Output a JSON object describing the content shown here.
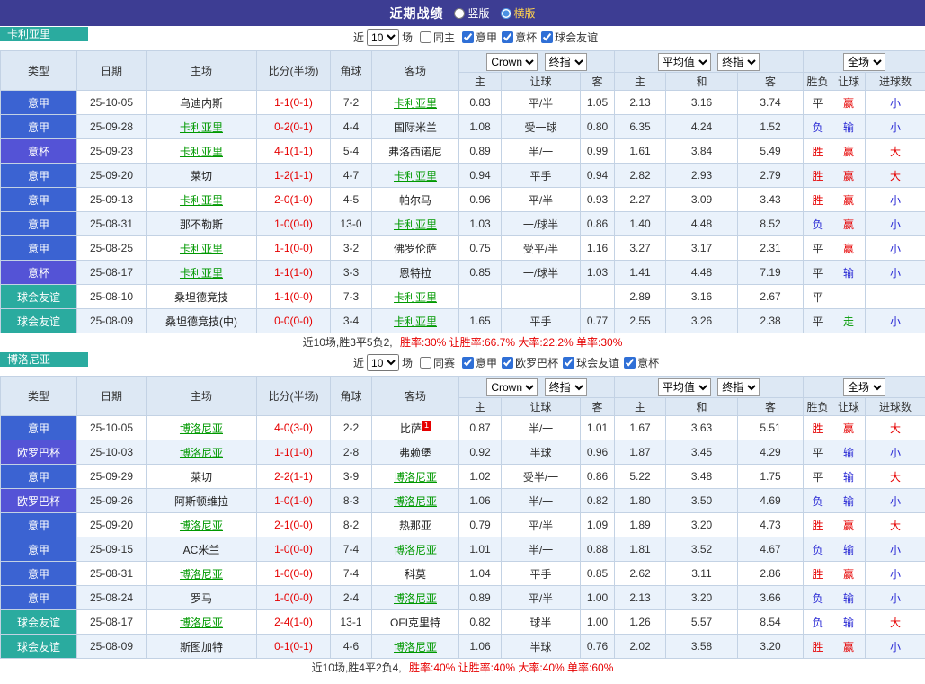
{
  "header": {
    "title": "近期战绩",
    "vertical_label": "竖版",
    "horizontal_label": "横版"
  },
  "labels": {
    "near": "近",
    "matches": "场"
  },
  "columns": {
    "type": "类型",
    "date": "日期",
    "home": "主场",
    "score": "比分(半场)",
    "corners": "角球",
    "away": "客场",
    "ah_home": "主",
    "ah_line": "让球",
    "ah_away": "客",
    "eu_home": "主",
    "eu_draw": "和",
    "eu_away": "客",
    "result": "胜负",
    "handicap": "让球",
    "goals": "进球数"
  },
  "selects": {
    "bookmaker": "Crown",
    "time": "终指",
    "euro_source": "平均值",
    "scope": "全场"
  },
  "league_colors": {
    "意甲": "#3b63d2",
    "意杯": "#5453d6",
    "欧罗巴杯": "#5453d6",
    "球会友谊": "#2aab9f"
  },
  "result_colors": {
    "胜": "#e60000",
    "平": "#333333",
    "负": "#2b2bd5",
    "赢": "#e60000",
    "输": "#2b2bd5",
    "走": "#009900",
    "大": "#e60000",
    "小": "#2b2bd5"
  },
  "sections": [
    {
      "team": "卡利亚里",
      "filters": {
        "count": "10",
        "same_label": "同主",
        "leagues": [
          "意甲",
          "意杯",
          "球会友谊"
        ]
      },
      "rows": [
        {
          "league": "意甲",
          "date": "25-10-05",
          "home": "乌迪内斯",
          "score": "1-1(0-1)",
          "corners": "7-2",
          "away": "卡利亚里",
          "ah_home": "0.83",
          "ah_line": "平/半",
          "ah_away": "1.05",
          "eu_home": "2.13",
          "eu_draw": "3.16",
          "eu_away": "3.74",
          "result": "平",
          "handicap_result": "赢",
          "goals": "小"
        },
        {
          "league": "意甲",
          "date": "25-09-28",
          "home": "卡利亚里",
          "score": "0-2(0-1)",
          "corners": "4-4",
          "away": "国际米兰",
          "ah_home": "1.08",
          "ah_line": "受一球",
          "ah_away": "0.80",
          "eu_home": "6.35",
          "eu_draw": "4.24",
          "eu_away": "1.52",
          "result": "负",
          "handicap_result": "输",
          "goals": "小"
        },
        {
          "league": "意杯",
          "date": "25-09-23",
          "home": "卡利亚里",
          "score": "4-1(1-1)",
          "corners": "5-4",
          "away": "弗洛西诺尼",
          "ah_home": "0.89",
          "ah_line": "半/一",
          "ah_away": "0.99",
          "eu_home": "1.61",
          "eu_draw": "3.84",
          "eu_away": "5.49",
          "result": "胜",
          "handicap_result": "赢",
          "goals": "大"
        },
        {
          "league": "意甲",
          "date": "25-09-20",
          "home": "莱切",
          "score": "1-2(1-1)",
          "corners": "4-7",
          "away": "卡利亚里",
          "ah_home": "0.94",
          "ah_line": "平手",
          "ah_away": "0.94",
          "eu_home": "2.82",
          "eu_draw": "2.93",
          "eu_away": "2.79",
          "result": "胜",
          "handicap_result": "赢",
          "goals": "大"
        },
        {
          "league": "意甲",
          "date": "25-09-13",
          "home": "卡利亚里",
          "score": "2-0(1-0)",
          "corners": "4-5",
          "away": "帕尔马",
          "ah_home": "0.96",
          "ah_line": "平/半",
          "ah_away": "0.93",
          "eu_home": "2.27",
          "eu_draw": "3.09",
          "eu_away": "3.43",
          "result": "胜",
          "handicap_result": "赢",
          "goals": "小"
        },
        {
          "league": "意甲",
          "date": "25-08-31",
          "home": "那不勒斯",
          "score": "1-0(0-0)",
          "corners": "13-0",
          "away": "卡利亚里",
          "ah_home": "1.03",
          "ah_line": "一/球半",
          "ah_away": "0.86",
          "eu_home": "1.40",
          "eu_draw": "4.48",
          "eu_away": "8.52",
          "result": "负",
          "handicap_result": "赢",
          "goals": "小"
        },
        {
          "league": "意甲",
          "date": "25-08-25",
          "home": "卡利亚里",
          "score": "1-1(0-0)",
          "corners": "3-2",
          "away": "佛罗伦萨",
          "ah_home": "0.75",
          "ah_line": "受平/半",
          "ah_away": "1.16",
          "eu_home": "3.27",
          "eu_draw": "3.17",
          "eu_away": "2.31",
          "result": "平",
          "handicap_result": "赢",
          "goals": "小"
        },
        {
          "league": "意杯",
          "date": "25-08-17",
          "home": "卡利亚里",
          "score": "1-1(1-0)",
          "corners": "3-3",
          "away": "恩特拉",
          "ah_home": "0.85",
          "ah_line": "一/球半",
          "ah_away": "1.03",
          "eu_home": "1.41",
          "eu_draw": "4.48",
          "eu_away": "7.19",
          "result": "平",
          "handicap_result": "输",
          "goals": "小"
        },
        {
          "league": "球会友谊",
          "date": "25-08-10",
          "home": "桑坦德竞技",
          "score": "1-1(0-0)",
          "corners": "7-3",
          "away": "卡利亚里",
          "ah_home": "",
          "ah_line": "",
          "ah_away": "",
          "eu_home": "2.89",
          "eu_draw": "3.16",
          "eu_away": "2.67",
          "result": "平",
          "handicap_result": "",
          "goals": ""
        },
        {
          "league": "球会友谊",
          "date": "25-08-09",
          "home": "桑坦德竞技(中)",
          "score": "0-0(0-0)",
          "corners": "3-4",
          "away": "卡利亚里",
          "ah_home": "1.65",
          "ah_line": "平手",
          "ah_away": "0.77",
          "eu_home": "2.55",
          "eu_draw": "3.26",
          "eu_away": "2.38",
          "result": "平",
          "handicap_result": "走",
          "goals": "小"
        }
      ],
      "summary": {
        "lead": "近10场,胜3平5负2,",
        "stats": "胜率:30% 让胜率:66.7% 大率:22.2% 单率:30%"
      }
    },
    {
      "team": "博洛尼亚",
      "filters": {
        "count": "10",
        "same_label": "同赛",
        "leagues": [
          "意甲",
          "欧罗巴杯",
          "球会友谊",
          "意杯"
        ]
      },
      "rows": [
        {
          "league": "意甲",
          "date": "25-10-05",
          "home": "博洛尼亚",
          "score": "4-0(3-0)",
          "corners": "2-2",
          "away": "比萨",
          "away_badge": "1",
          "ah_home": "0.87",
          "ah_line": "半/一",
          "ah_away": "1.01",
          "eu_home": "1.67",
          "eu_draw": "3.63",
          "eu_away": "5.51",
          "result": "胜",
          "handicap_result": "赢",
          "goals": "大"
        },
        {
          "league": "欧罗巴杯",
          "date": "25-10-03",
          "home": "博洛尼亚",
          "score": "1-1(1-0)",
          "corners": "2-8",
          "away": "弗赖堡",
          "ah_home": "0.92",
          "ah_line": "半球",
          "ah_away": "0.96",
          "eu_home": "1.87",
          "eu_draw": "3.45",
          "eu_away": "4.29",
          "result": "平",
          "handicap_result": "输",
          "goals": "小"
        },
        {
          "league": "意甲",
          "date": "25-09-29",
          "home": "莱切",
          "score": "2-2(1-1)",
          "corners": "3-9",
          "away": "博洛尼亚",
          "ah_home": "1.02",
          "ah_line": "受半/一",
          "ah_away": "0.86",
          "eu_home": "5.22",
          "eu_draw": "3.48",
          "eu_away": "1.75",
          "result": "平",
          "handicap_result": "输",
          "goals": "大"
        },
        {
          "league": "欧罗巴杯",
          "date": "25-09-26",
          "home": "阿斯顿维拉",
          "score": "1-0(1-0)",
          "corners": "8-3",
          "away": "博洛尼亚",
          "ah_home": "1.06",
          "ah_line": "半/一",
          "ah_away": "0.82",
          "eu_home": "1.80",
          "eu_draw": "3.50",
          "eu_away": "4.69",
          "result": "负",
          "handicap_result": "输",
          "goals": "小"
        },
        {
          "league": "意甲",
          "date": "25-09-20",
          "home": "博洛尼亚",
          "score": "2-1(0-0)",
          "corners": "8-2",
          "away": "热那亚",
          "ah_home": "0.79",
          "ah_line": "平/半",
          "ah_away": "1.09",
          "eu_home": "1.89",
          "eu_draw": "3.20",
          "eu_away": "4.73",
          "result": "胜",
          "handicap_result": "赢",
          "goals": "大"
        },
        {
          "league": "意甲",
          "date": "25-09-15",
          "home": "AC米兰",
          "score": "1-0(0-0)",
          "corners": "7-4",
          "away": "博洛尼亚",
          "ah_home": "1.01",
          "ah_line": "半/一",
          "ah_away": "0.88",
          "eu_home": "1.81",
          "eu_draw": "3.52",
          "eu_away": "4.67",
          "result": "负",
          "handicap_result": "输",
          "goals": "小"
        },
        {
          "league": "意甲",
          "date": "25-08-31",
          "home": "博洛尼亚",
          "score": "1-0(0-0)",
          "corners": "7-4",
          "away": "科莫",
          "ah_home": "1.04",
          "ah_line": "平手",
          "ah_away": "0.85",
          "eu_home": "2.62",
          "eu_draw": "3.11",
          "eu_away": "2.86",
          "result": "胜",
          "handicap_result": "赢",
          "goals": "小"
        },
        {
          "league": "意甲",
          "date": "25-08-24",
          "home": "罗马",
          "score": "1-0(0-0)",
          "corners": "2-4",
          "away": "博洛尼亚",
          "ah_home": "0.89",
          "ah_line": "平/半",
          "ah_away": "1.00",
          "eu_home": "2.13",
          "eu_draw": "3.20",
          "eu_away": "3.66",
          "result": "负",
          "handicap_result": "输",
          "goals": "小"
        },
        {
          "league": "球会友谊",
          "date": "25-08-17",
          "home": "博洛尼亚",
          "score": "2-4(1-0)",
          "corners": "13-1",
          "away": "OFI克里特",
          "ah_home": "0.82",
          "ah_line": "球半",
          "ah_away": "1.00",
          "eu_home": "1.26",
          "eu_draw": "5.57",
          "eu_away": "8.54",
          "result": "负",
          "handicap_result": "输",
          "goals": "大"
        },
        {
          "league": "球会友谊",
          "date": "25-08-09",
          "home": "斯图加特",
          "score": "0-1(0-1)",
          "corners": "4-6",
          "away": "博洛尼亚",
          "ah_home": "1.06",
          "ah_line": "半球",
          "ah_away": "0.76",
          "eu_home": "2.02",
          "eu_draw": "3.58",
          "eu_away": "3.20",
          "result": "胜",
          "handicap_result": "赢",
          "goals": "小"
        }
      ],
      "summary": {
        "lead": "近10场,胜4平2负4,",
        "stats": "胜率:40% 让胜率:40% 大率:40% 单率:60%"
      }
    }
  ]
}
